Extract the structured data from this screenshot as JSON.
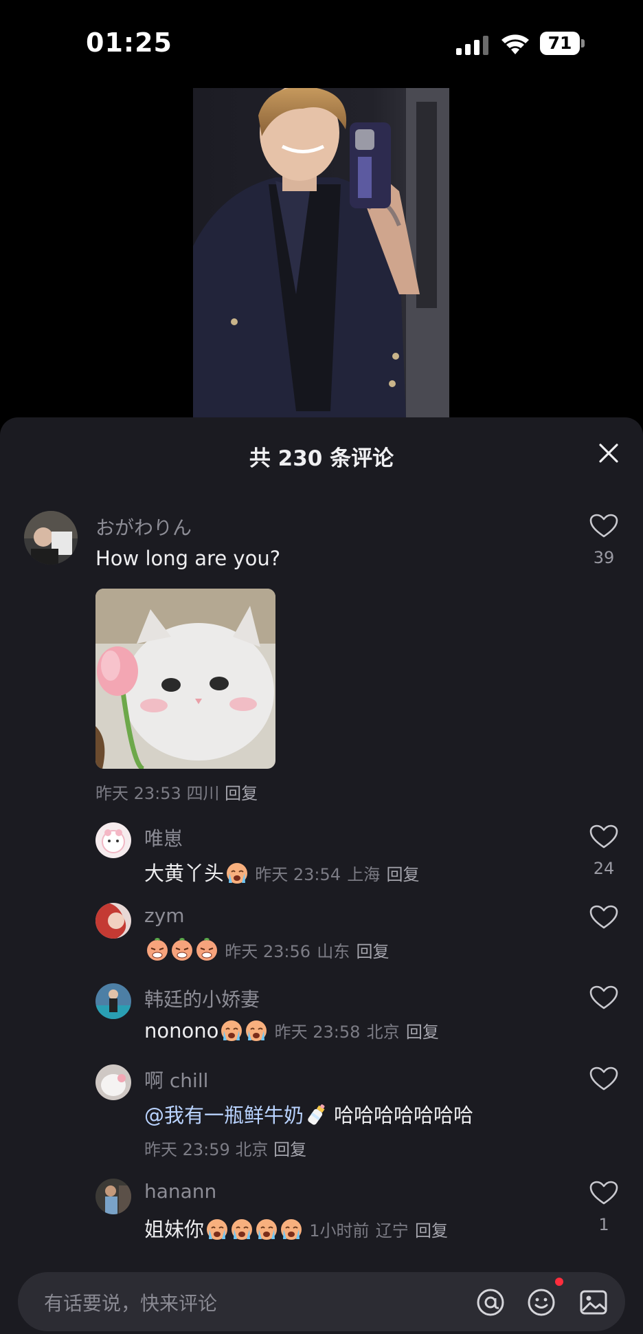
{
  "status_bar": {
    "time": "01:25",
    "battery": "71"
  },
  "sheet": {
    "title": "共 230 条评论"
  },
  "comments": [
    {
      "user": "おがわりん",
      "text": "How long are you?",
      "time": "昨天 23:53",
      "location": "四川",
      "reply": "回复",
      "likes": "39"
    },
    {
      "user": "唯崽",
      "text": "大黄丫头",
      "time": "昨天 23:54",
      "location": "上海",
      "reply": "回复",
      "likes": "24"
    },
    {
      "user": "zym",
      "text": "",
      "time": "昨天 23:56",
      "location": "山东",
      "reply": "回复",
      "likes": ""
    },
    {
      "user": "韩廷的小娇妻",
      "text": "nonono",
      "time": "昨天 23:58",
      "location": "北京",
      "reply": "回复",
      "likes": ""
    },
    {
      "user": "啊 chill",
      "mention": "@我有一瓶鲜牛奶",
      "text": "哈哈哈哈哈哈哈",
      "time": "昨天 23:59",
      "location": "北京",
      "reply": "回复",
      "likes": ""
    },
    {
      "user": "hanann",
      "text": "姐妹你",
      "time": "1小时前",
      "location": "辽宁",
      "reply": "回复",
      "likes": "1"
    }
  ],
  "input": {
    "placeholder": "有话要说，快来评论"
  },
  "icons": [
    "signal-icon",
    "wifi-icon",
    "battery-icon",
    "close-icon",
    "heart-icon",
    "at-icon",
    "emoji-icon",
    "image-icon",
    "crying-emoji-icon",
    "sob-emoji-icon",
    "milk-bottle-icon"
  ],
  "colors": {
    "sheet_bg": "#1b1b21",
    "input_bg": "#2c2c33",
    "notification_dot": "#ff2d3d"
  }
}
